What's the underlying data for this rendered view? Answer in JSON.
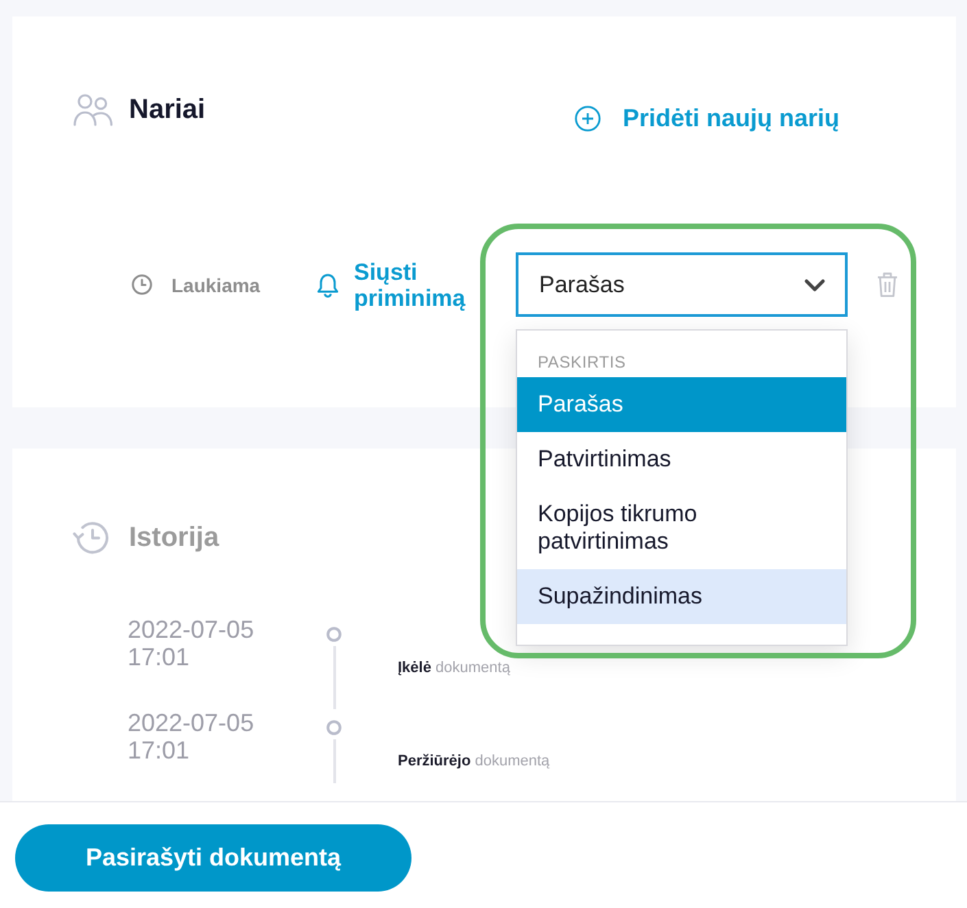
{
  "members": {
    "title": "Nariai",
    "add_member": "Pridėti naujų narių",
    "rows": [
      {
        "status": "Laukiama",
        "reminder": "Siųsti priminimą",
        "role_select": {
          "value": "Parašas",
          "expanded": true
        },
        "dropdown": {
          "header": "PASKIRTIS",
          "options": [
            {
              "label": "Parašas",
              "selected": true,
              "highlighted": false
            },
            {
              "label": "Patvirtinimas",
              "selected": false,
              "highlighted": false
            },
            {
              "label": "Kopijos tikrumo patvirtinimas",
              "selected": false,
              "highlighted": false
            },
            {
              "label": "Supažindinimas",
              "selected": false,
              "highlighted": true
            }
          ]
        },
        "highlight_frame": true
      }
    ]
  },
  "history": {
    "title": "Istorija",
    "events": [
      {
        "date": "2022-07-05",
        "time": "17:01",
        "text": "**Įkėlė** dokumentą"
      },
      {
        "date": "2022-07-05",
        "time": "17:01",
        "text": "**Peržiūrėjo** dokumentą"
      }
    ]
  },
  "footer": {
    "sign_button": "Pasirašyti dokumentą"
  }
}
